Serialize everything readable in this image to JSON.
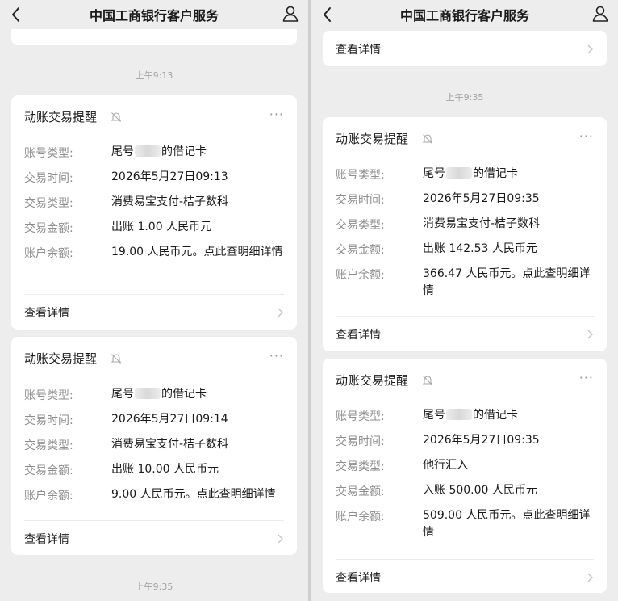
{
  "header": {
    "title": "中国工商银行客户服务"
  },
  "common": {
    "card_title": "动账交易提醒",
    "more_label": "···",
    "detail_label": "查看详情",
    "labels": {
      "account_type": "账号类型:",
      "time": "交易时间:",
      "type": "交易类型:",
      "amount": "交易金额:",
      "balance": "账户余额:"
    },
    "account_prefix": "尾号",
    "account_suffix": "的借记卡"
  },
  "left": {
    "ts1": "上午9:13",
    "ts2": "上午9:35",
    "card1": {
      "time": "2026年5月27日09:13",
      "type": "消费易宝支付-桔子数科",
      "amount": "出账 1.00 人民币元",
      "balance": "19.00 人民币元。点此查明细详情"
    },
    "card2": {
      "time": "2026年5月27日09:14",
      "type": "消费易宝支付-桔子数科",
      "amount": "出账 10.00 人民币元",
      "balance": "9.00 人民币元。点此查明细详情"
    }
  },
  "right": {
    "ts1": "上午9:35",
    "card1": {
      "time": "2026年5月27日09:35",
      "type": "消费易宝支付-桔子数科",
      "amount": "出账 142.53 人民币元",
      "balance": "366.47 人民币元。点此查明细详情"
    },
    "card2": {
      "time": "2026年5月27日09:35",
      "type": "他行汇入",
      "amount": "入账 500.00 人民币元",
      "balance": "509.00 人民币元。点此查明细详情"
    }
  }
}
